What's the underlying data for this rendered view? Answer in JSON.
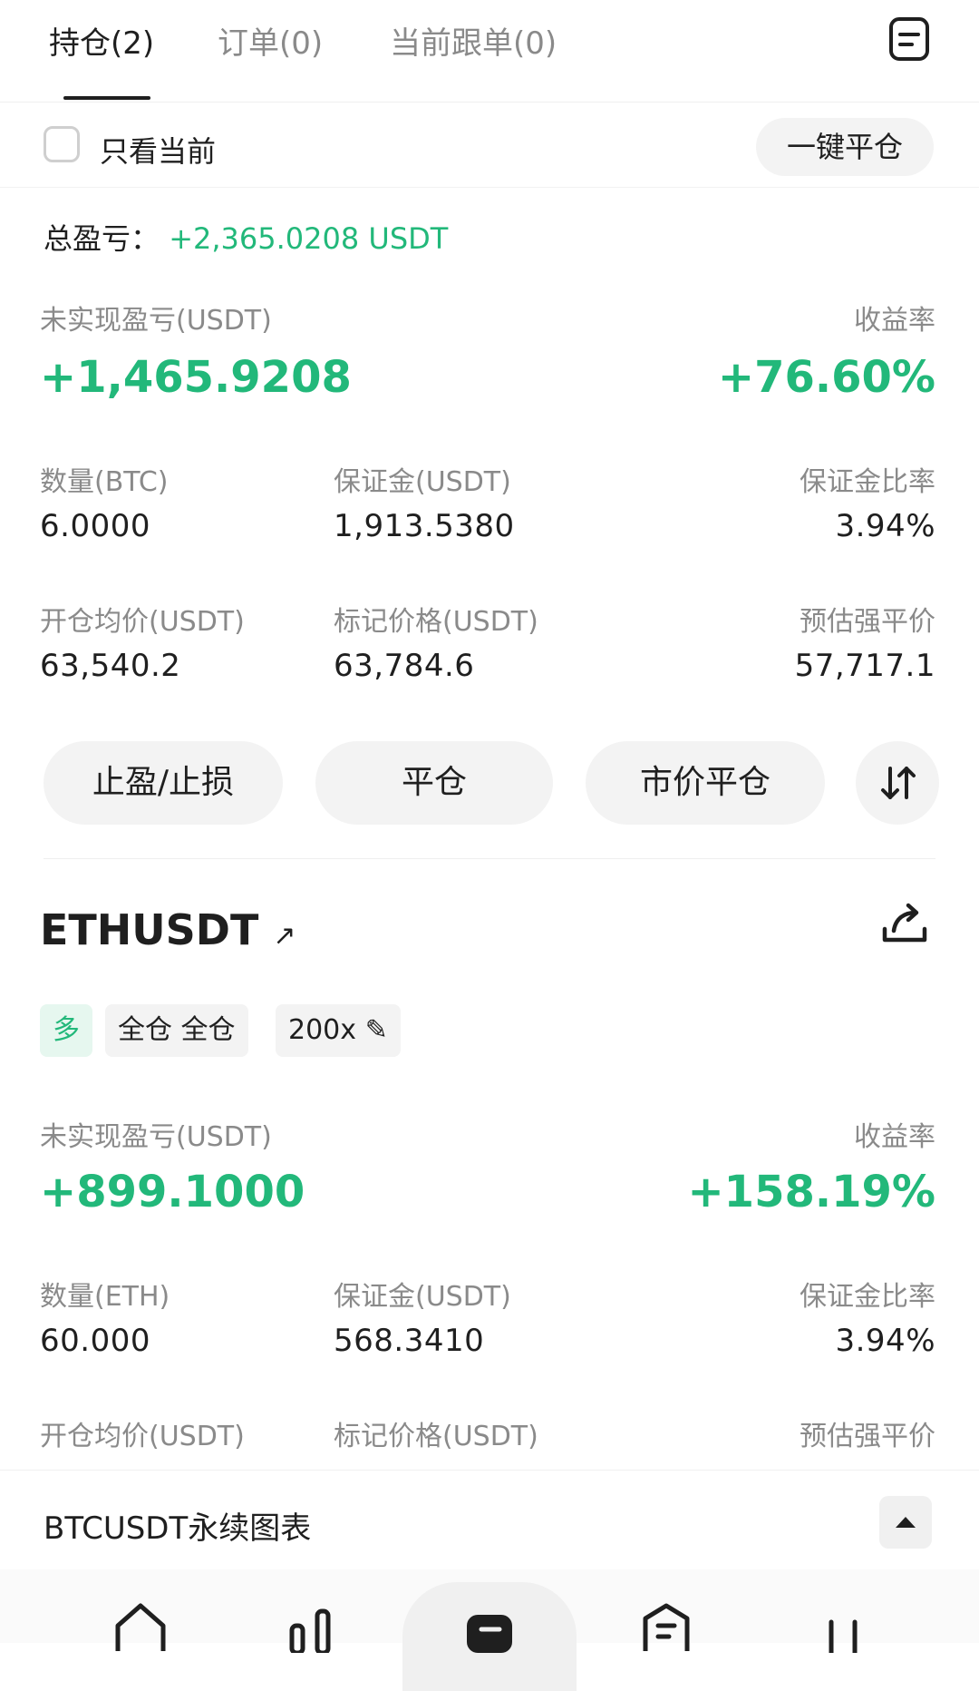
{
  "tabs": [
    {
      "label": "持仓(2)"
    },
    {
      "label": "订单(0)"
    },
    {
      "label": "当前跟单(0)"
    }
  ],
  "filter": {
    "only_current_label": "只看当前",
    "close_all_label": "一键平仓"
  },
  "total_pnl": {
    "label": "总盈亏：",
    "value": "+2,365.0208 USDT"
  },
  "position1": {
    "pnl_label": "未实现盈亏(USDT)",
    "roi_label": "收益率",
    "pnl_value": "+1,465.9208",
    "roi_value": "+76.60%",
    "qty_label": "数量(BTC)",
    "margin_label": "保证金(USDT)",
    "margin_ratio_label": "保证金比率",
    "qty_value": "6.0000",
    "margin_value": "1,913.5380",
    "margin_ratio_value": "3.94%",
    "entry_label": "开仓均价(USDT)",
    "mark_label": "标记价格(USDT)",
    "liq_label": "预估强平价",
    "entry_value": "63,540.2",
    "mark_value": "63,784.6",
    "liq_value": "57,717.1"
  },
  "actions": {
    "tp_sl": "止盈/止损",
    "close": "平仓",
    "market_close": "市价平仓"
  },
  "position2": {
    "symbol": "ETHUSDT",
    "side_tag": "多",
    "mode_tag": "全仓 全仓",
    "leverage_tag": "200x",
    "pnl_label": "未实现盈亏(USDT)",
    "roi_label": "收益率",
    "pnl_value": "+899.1000",
    "roi_value": "+158.19%",
    "qty_label": "数量(ETH)",
    "margin_label": "保证金(USDT)",
    "margin_ratio_label": "保证金比率",
    "qty_value": "60.000",
    "margin_value": "568.3410",
    "margin_ratio_value": "3.94%",
    "entry_label": "开仓均价(USDT)",
    "mark_label": "标记价格(USDT)",
    "liq_label": "预估强平价"
  },
  "chart_bar": {
    "title": "BTCUSDT永续图表"
  },
  "colors": {
    "accent_green": "#22b87a",
    "muted_text": "#8a8a8a",
    "button_bg": "#f3f3f3"
  },
  "icons": {
    "doc": "document-icon",
    "share": "share-icon",
    "swap": "swap-arrows-icon",
    "collapse": "chevron-up-icon",
    "nav": [
      "home-icon",
      "markets-icon",
      "trade-icon",
      "assets-icon",
      "profile-icon"
    ]
  }
}
